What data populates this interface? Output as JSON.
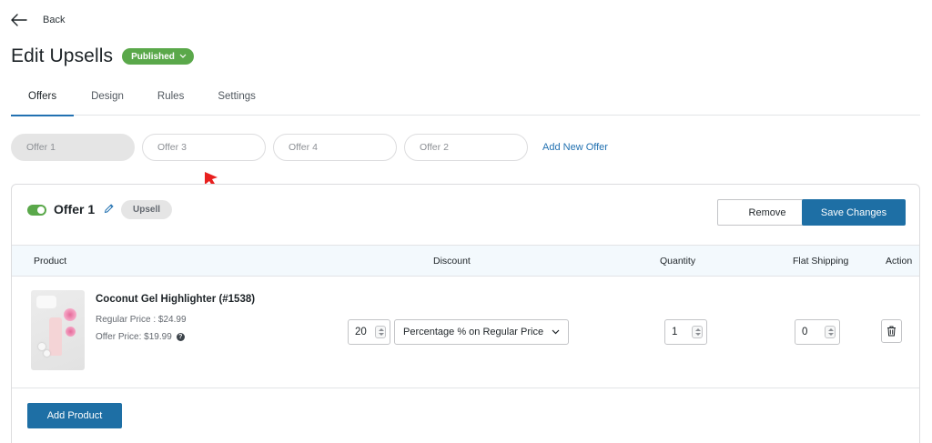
{
  "nav": {
    "back_label": "Back",
    "back_icon": "arrow-left-icon"
  },
  "header": {
    "title": "Edit Upsells",
    "status": "Published"
  },
  "tabs": [
    {
      "label": "Offers",
      "active": true
    },
    {
      "label": "Design",
      "active": false
    },
    {
      "label": "Rules",
      "active": false
    },
    {
      "label": "Settings",
      "active": false
    }
  ],
  "offers": {
    "items": [
      {
        "label": "Offer 1",
        "active": true
      },
      {
        "label": "Offer 3",
        "active": false
      },
      {
        "label": "Offer 4",
        "active": false
      },
      {
        "label": "Offer 2",
        "active": false
      }
    ],
    "add_label": "Add New Offer"
  },
  "panel": {
    "offer_name": "Offer 1",
    "enabled": true,
    "type_badge": "Upsell",
    "remove_label": "Remove",
    "save_label": "Save Changes",
    "columns": {
      "product": "Product",
      "discount": "Discount",
      "quantity": "Quantity",
      "flat_shipping": "Flat Shipping",
      "action": "Action"
    },
    "row": {
      "name": "Coconut Gel Highlighter (#1538)",
      "regular_price": "Regular Price : $24.99",
      "offer_price": "Offer Price: $19.99",
      "discount_value": "20",
      "discount_type": "Percentage % on Regular Price",
      "quantity": "1",
      "flat_shipping": "0"
    },
    "add_product_label": "Add Product"
  },
  "colors": {
    "accent": "#1e6fa5",
    "link": "#2271b1",
    "published": "#5aa84a",
    "annotation_arrow": "#e8201f"
  }
}
